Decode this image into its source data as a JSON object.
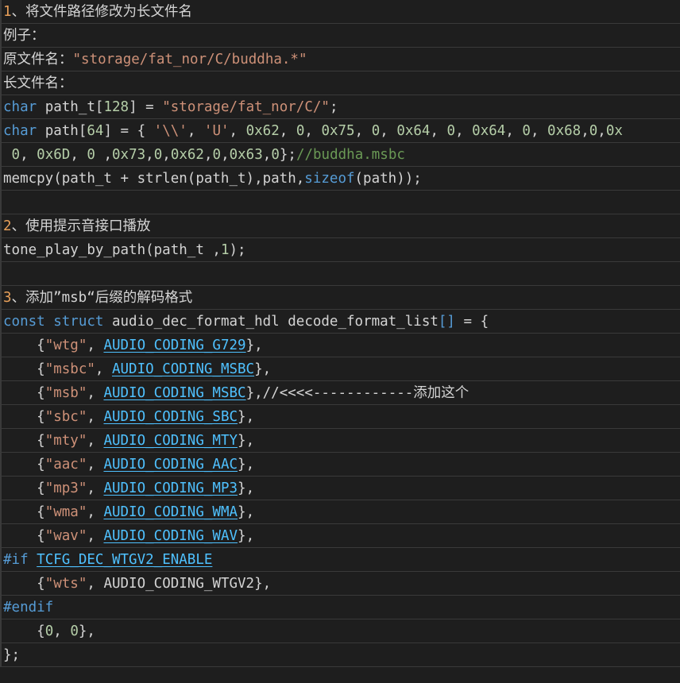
{
  "colors": {
    "background": "#1e1e1e",
    "default": "#d4d4d4",
    "keyword": "#569cd6",
    "string": "#ce9178",
    "number": "#b5cea8",
    "comment": "#6a9955",
    "macro": "#4fc1ff",
    "orange_number": "#e8a05a"
  },
  "lines": [
    [
      {
        "t": "1",
        "c": "c-orange"
      },
      {
        "t": "、将文件路径修改为长文件名",
        "c": "c-cjk"
      }
    ],
    [
      {
        "t": "例子：",
        "c": "c-cjk"
      }
    ],
    [
      {
        "t": "原文件名：",
        "c": "c-cjk"
      },
      {
        "t": "\"storage/fat_nor/C/buddha.*\"",
        "c": "c-str"
      }
    ],
    [
      {
        "t": "长文件名：",
        "c": "c-cjk"
      }
    ],
    [
      {
        "t": "char",
        "c": "c-kw"
      },
      {
        "t": " path_t[",
        "c": "c-default"
      },
      {
        "t": "128",
        "c": "c-num"
      },
      {
        "t": "] = ",
        "c": "c-default"
      },
      {
        "t": "\"storage/fat_nor/C/\"",
        "c": "c-str"
      },
      {
        "t": ";",
        "c": "c-default"
      }
    ],
    [
      {
        "t": "char",
        "c": "c-kw"
      },
      {
        "t": " path[",
        "c": "c-default"
      },
      {
        "t": "64",
        "c": "c-num"
      },
      {
        "t": "] = { ",
        "c": "c-default"
      },
      {
        "t": "'\\\\'",
        "c": "c-str"
      },
      {
        "t": ", ",
        "c": "c-default"
      },
      {
        "t": "'U'",
        "c": "c-str"
      },
      {
        "t": ", ",
        "c": "c-default"
      },
      {
        "t": "0x62",
        "c": "c-num"
      },
      {
        "t": ", ",
        "c": "c-default"
      },
      {
        "t": "0",
        "c": "c-num"
      },
      {
        "t": ", ",
        "c": "c-default"
      },
      {
        "t": "0x75",
        "c": "c-num"
      },
      {
        "t": ", ",
        "c": "c-default"
      },
      {
        "t": "0",
        "c": "c-num"
      },
      {
        "t": ", ",
        "c": "c-default"
      },
      {
        "t": "0x64",
        "c": "c-num"
      },
      {
        "t": ", ",
        "c": "c-default"
      },
      {
        "t": "0",
        "c": "c-num"
      },
      {
        "t": ", ",
        "c": "c-default"
      },
      {
        "t": "0x64",
        "c": "c-num"
      },
      {
        "t": ", ",
        "c": "c-default"
      },
      {
        "t": "0",
        "c": "c-num"
      },
      {
        "t": ", ",
        "c": "c-default"
      },
      {
        "t": "0x68",
        "c": "c-num"
      },
      {
        "t": ",",
        "c": "c-default"
      },
      {
        "t": "0",
        "c": "c-num"
      },
      {
        "t": ",",
        "c": "c-default"
      },
      {
        "t": "0x",
        "c": "c-num"
      }
    ],
    [
      {
        "t": " 0",
        "c": "c-num"
      },
      {
        "t": ", ",
        "c": "c-default"
      },
      {
        "t": "0x6D",
        "c": "c-num"
      },
      {
        "t": ", ",
        "c": "c-default"
      },
      {
        "t": "0",
        "c": "c-num"
      },
      {
        "t": " ,",
        "c": "c-default"
      },
      {
        "t": "0x73",
        "c": "c-num"
      },
      {
        "t": ",",
        "c": "c-default"
      },
      {
        "t": "0",
        "c": "c-num"
      },
      {
        "t": ",",
        "c": "c-default"
      },
      {
        "t": "0x62",
        "c": "c-num"
      },
      {
        "t": ",",
        "c": "c-default"
      },
      {
        "t": "0",
        "c": "c-num"
      },
      {
        "t": ",",
        "c": "c-default"
      },
      {
        "t": "0x63",
        "c": "c-num"
      },
      {
        "t": ",",
        "c": "c-default"
      },
      {
        "t": "0",
        "c": "c-num"
      },
      {
        "t": "};",
        "c": "c-default"
      },
      {
        "t": "//buddha.msbc",
        "c": "c-comment"
      }
    ],
    [
      {
        "t": "memcpy(path_t + strlen(path_t),path,",
        "c": "c-default"
      },
      {
        "t": "sizeof",
        "c": "c-kw"
      },
      {
        "t": "(path));",
        "c": "c-default"
      }
    ],
    [],
    [
      {
        "t": "2",
        "c": "c-orange"
      },
      {
        "t": "、使用提示音接口播放",
        "c": "c-cjk"
      }
    ],
    [
      {
        "t": "tone_play_by_path(path_t ,",
        "c": "c-default"
      },
      {
        "t": "1",
        "c": "c-num"
      },
      {
        "t": ");",
        "c": "c-default"
      }
    ],
    [],
    [
      {
        "t": "3",
        "c": "c-orange"
      },
      {
        "t": "、添加",
        "c": "c-cjk"
      },
      {
        "t": "”msb“",
        "c": "c-default"
      },
      {
        "t": "后缀的解码格式",
        "c": "c-cjk"
      }
    ],
    [
      {
        "t": "const",
        "c": "c-kw"
      },
      {
        "t": " ",
        "c": "c-default"
      },
      {
        "t": "struct",
        "c": "c-kw"
      },
      {
        "t": " audio_dec_format_hdl decode_format_list",
        "c": "c-default"
      },
      {
        "t": "[]",
        "c": "c-kw"
      },
      {
        "t": " = {",
        "c": "c-default"
      }
    ],
    [
      {
        "t": "    {",
        "c": "c-default"
      },
      {
        "t": "\"wtg\"",
        "c": "c-str"
      },
      {
        "t": ", ",
        "c": "c-default"
      },
      {
        "t": "AUDIO_CODING_G729",
        "c": "c-macro underline"
      },
      {
        "t": "},",
        "c": "c-default"
      }
    ],
    [
      {
        "t": "    {",
        "c": "c-default"
      },
      {
        "t": "\"msbc\"",
        "c": "c-str"
      },
      {
        "t": ", ",
        "c": "c-default"
      },
      {
        "t": "AUDIO_CODING_MSBC",
        "c": "c-macro underline"
      },
      {
        "t": "},",
        "c": "c-default"
      }
    ],
    [
      {
        "t": "    {",
        "c": "c-default"
      },
      {
        "t": "\"msb\"",
        "c": "c-str"
      },
      {
        "t": ", ",
        "c": "c-default"
      },
      {
        "t": "AUDIO_CODING_MSBC",
        "c": "c-macro underline"
      },
      {
        "t": "},//<<<<------------",
        "c": "c-default"
      },
      {
        "t": "添加这个",
        "c": "c-cjk"
      }
    ],
    [
      {
        "t": "    {",
        "c": "c-default"
      },
      {
        "t": "\"sbc\"",
        "c": "c-str"
      },
      {
        "t": ", ",
        "c": "c-default"
      },
      {
        "t": "AUDIO_CODING_SBC",
        "c": "c-macro underline"
      },
      {
        "t": "},",
        "c": "c-default"
      }
    ],
    [
      {
        "t": "    {",
        "c": "c-default"
      },
      {
        "t": "\"mty\"",
        "c": "c-str"
      },
      {
        "t": ", ",
        "c": "c-default"
      },
      {
        "t": "AUDIO_CODING_MTY",
        "c": "c-macro underline"
      },
      {
        "t": "},",
        "c": "c-default"
      }
    ],
    [
      {
        "t": "    {",
        "c": "c-default"
      },
      {
        "t": "\"aac\"",
        "c": "c-str"
      },
      {
        "t": ", ",
        "c": "c-default"
      },
      {
        "t": "AUDIO_CODING_AAC",
        "c": "c-macro underline"
      },
      {
        "t": "},",
        "c": "c-default"
      }
    ],
    [
      {
        "t": "    {",
        "c": "c-default"
      },
      {
        "t": "\"mp3\"",
        "c": "c-str"
      },
      {
        "t": ", ",
        "c": "c-default"
      },
      {
        "t": "AUDIO_CODING_MP3",
        "c": "c-macro underline"
      },
      {
        "t": "},",
        "c": "c-default"
      }
    ],
    [
      {
        "t": "    {",
        "c": "c-default"
      },
      {
        "t": "\"wma\"",
        "c": "c-str"
      },
      {
        "t": ", ",
        "c": "c-default"
      },
      {
        "t": "AUDIO_CODING_WMA",
        "c": "c-macro underline"
      },
      {
        "t": "},",
        "c": "c-default"
      }
    ],
    [
      {
        "t": "    {",
        "c": "c-default"
      },
      {
        "t": "\"wav\"",
        "c": "c-str"
      },
      {
        "t": ", ",
        "c": "c-default"
      },
      {
        "t": "AUDIO_CODING_WAV",
        "c": "c-macro underline"
      },
      {
        "t": "},",
        "c": "c-default"
      }
    ],
    [
      {
        "t": "#if",
        "c": "c-kw"
      },
      {
        "t": " ",
        "c": "c-default"
      },
      {
        "t": "TCFG_DEC_WTGV2_ENABLE",
        "c": "c-macro underline"
      }
    ],
    [
      {
        "t": "    {",
        "c": "c-default"
      },
      {
        "t": "\"wts\"",
        "c": "c-str"
      },
      {
        "t": ", AUDIO_CODING_WTGV2},",
        "c": "c-default"
      }
    ],
    [
      {
        "t": "#endif",
        "c": "c-kw"
      }
    ],
    [
      {
        "t": "    {",
        "c": "c-default"
      },
      {
        "t": "0",
        "c": "c-num"
      },
      {
        "t": ", ",
        "c": "c-default"
      },
      {
        "t": "0",
        "c": "c-num"
      },
      {
        "t": "},",
        "c": "c-default"
      }
    ],
    [
      {
        "t": "};",
        "c": "c-default"
      }
    ]
  ]
}
